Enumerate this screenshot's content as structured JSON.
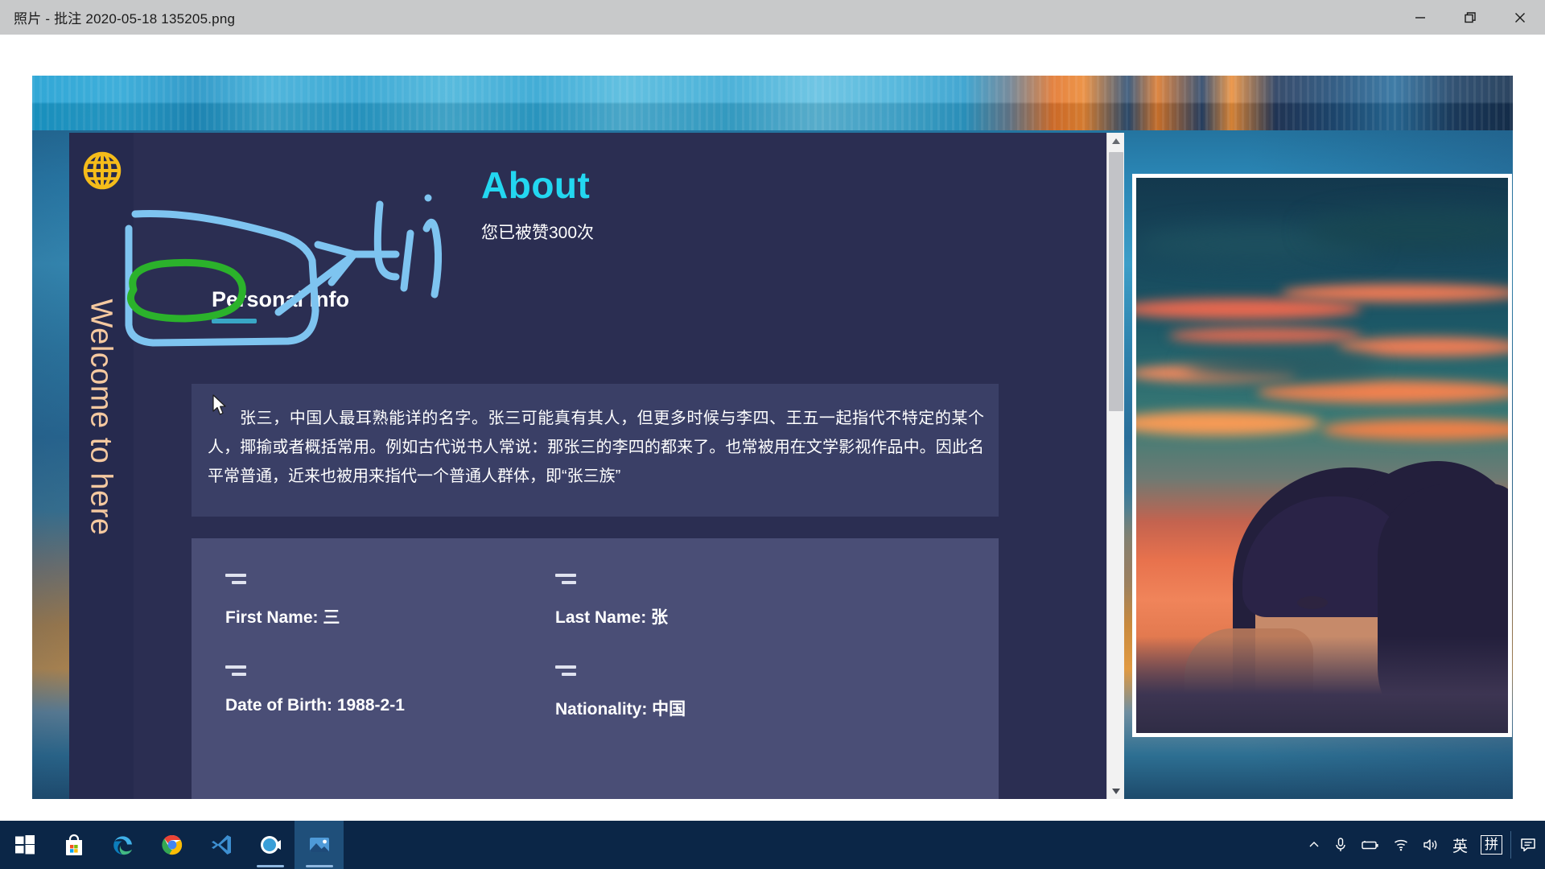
{
  "window": {
    "title": "照片 - 批注 2020-05-18 135205.png",
    "controls": [
      {
        "name": "minimize-button",
        "glyph": "minimize"
      },
      {
        "name": "restore-button",
        "glyph": "restore"
      },
      {
        "name": "close-button",
        "glyph": "close"
      }
    ]
  },
  "page": {
    "brand_icon": "globe-icon",
    "vertical_text": "Welcome to here",
    "header": {
      "title": "About",
      "subtitle": "您已被赞300次",
      "section_heading": "Personal Info"
    },
    "bio": {
      "text": "张三，中国人最耳熟能详的名字。张三可能真有其人，但更多时候与李四、王五一起指代不特定的某个人，揶揄或者概括常用。例如古代说书人常说：那张三的李四的都来了。也常被用在文学影视作品中。因此名平常普通，近来也被用来指代一个普通人群体，即“张三族”"
    },
    "info_fields": [
      {
        "name": "first-name-field",
        "label": "First Name: 三"
      },
      {
        "name": "last-name-field",
        "label": "Last Name: 张"
      },
      {
        "name": "date-of-birth-field",
        "label": "Date of Birth: 1988-2-1"
      },
      {
        "name": "nationality-field",
        "label": "Nationality: 中国"
      }
    ]
  },
  "annotations": {
    "tip_label": "tip",
    "ink_color": "#7ec4f0",
    "highlight_color": "#2bb22b"
  },
  "colors": {
    "about_cyan": "#23d7f0",
    "page_bg": "#2b2e52",
    "bio_panel": "#3a3f66",
    "info_panel": "#4a4e76",
    "welcome_peach": "#f5c9a0",
    "globe_gold": "#f5bc1a",
    "taskbar": "#0b2647",
    "titlebar": "#c8c9ca"
  },
  "taskbar": {
    "items": [
      {
        "name": "start-button",
        "icon": "windows-logo-icon",
        "active": false,
        "running": false
      },
      {
        "name": "taskbar-item-store",
        "icon": "microsoft-store-icon",
        "active": false,
        "running": false
      },
      {
        "name": "taskbar-item-edge",
        "icon": "edge-icon",
        "active": false,
        "running": false
      },
      {
        "name": "taskbar-item-chrome",
        "icon": "chrome-icon",
        "active": false,
        "running": true
      },
      {
        "name": "taskbar-item-vscode",
        "icon": "vscode-icon",
        "active": false,
        "running": false
      },
      {
        "name": "taskbar-item-meeting",
        "icon": "video-camera-icon",
        "active": false,
        "running": true
      },
      {
        "name": "taskbar-item-photos",
        "icon": "photos-icon",
        "active": true,
        "running": true
      }
    ],
    "tray": [
      {
        "name": "show-hidden-icons-button",
        "icon": "chevron-up-icon",
        "text": ""
      },
      {
        "name": "microphone-icon",
        "icon": "microphone-icon",
        "text": ""
      },
      {
        "name": "battery-icon",
        "icon": "battery-icon",
        "text": ""
      },
      {
        "name": "wifi-icon",
        "icon": "wifi-icon",
        "text": ""
      },
      {
        "name": "volume-icon",
        "icon": "volume-icon",
        "text": ""
      },
      {
        "name": "ime-language-indicator",
        "icon": "text",
        "text": "英"
      },
      {
        "name": "ime-mode-indicator",
        "icon": "boxed-text",
        "text": "拼"
      },
      {
        "name": "notification-center-button",
        "icon": "notification-icon",
        "text": ""
      }
    ]
  }
}
